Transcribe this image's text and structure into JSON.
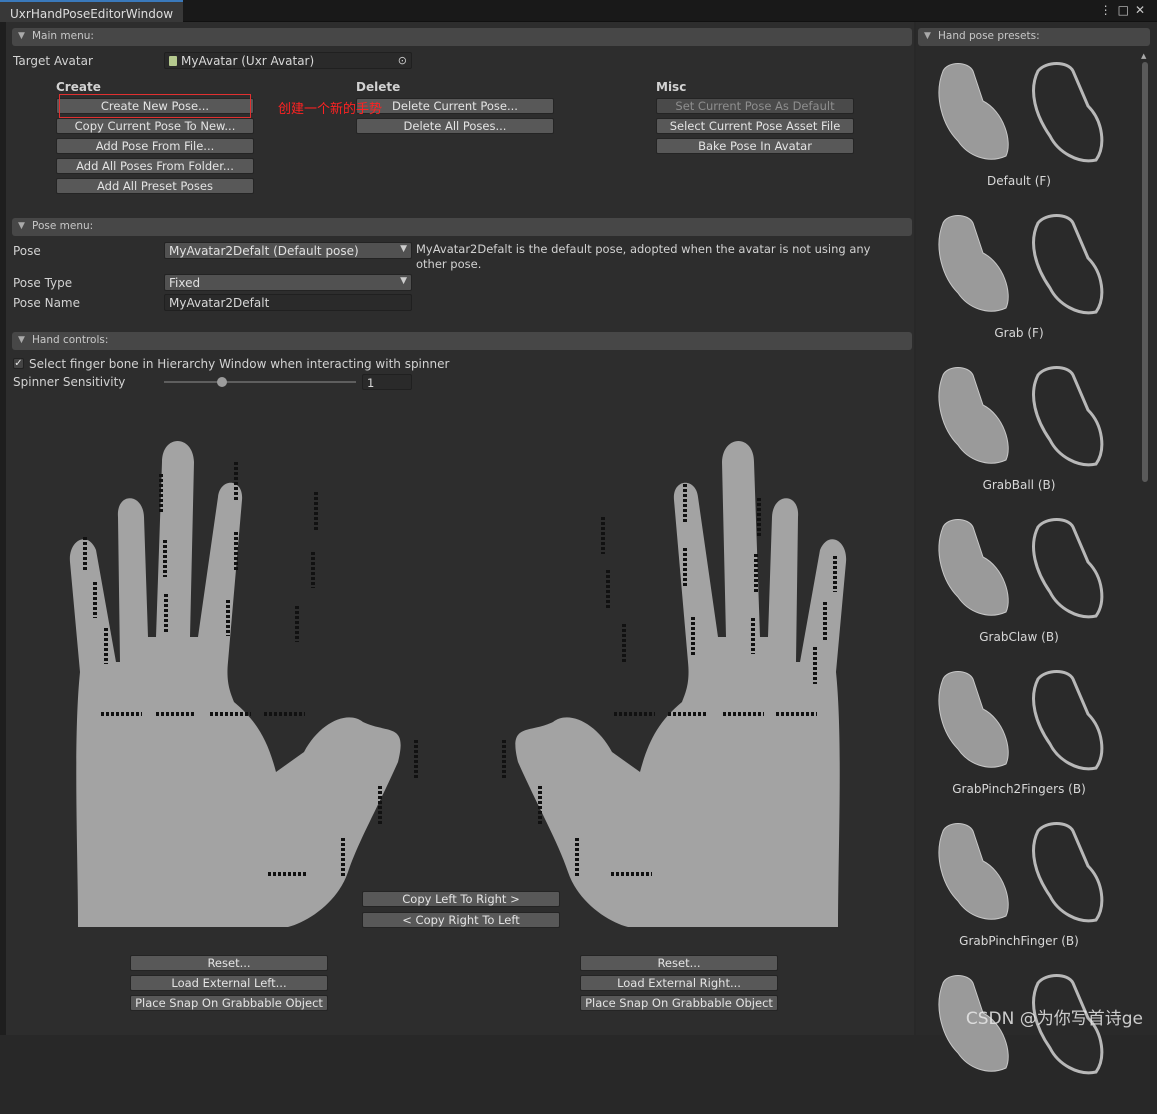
{
  "window": {
    "tab_title": "UxrHandPoseEditorWindow"
  },
  "main_menu": {
    "header": "Main menu:",
    "target_avatar_label": "Target Avatar",
    "target_avatar_value": "MyAvatar (Uxr Avatar)",
    "create": {
      "title": "Create",
      "buttons": [
        "Create New Pose...",
        "Copy Current Pose To New...",
        "Add Pose From File...",
        "Add All Poses From Folder...",
        "Add All Preset Poses"
      ]
    },
    "delete": {
      "title": "Delete",
      "buttons": [
        "Delete Current Pose...",
        "Delete All Poses..."
      ]
    },
    "misc": {
      "title": "Misc",
      "buttons": [
        "Set Current Pose As Default",
        "Select Current Pose Asset File",
        "Bake Pose In Avatar"
      ]
    }
  },
  "annotation": {
    "text": "创建一个新的手势",
    "color": "#e03030"
  },
  "pose_menu": {
    "header": "Pose menu:",
    "pose_label": "Pose",
    "pose_value": "MyAvatar2Defalt (Default pose)",
    "pose_info": "MyAvatar2Defalt is the default pose, adopted when the avatar is not using any other pose.",
    "pose_type_label": "Pose Type",
    "pose_type_value": "Fixed",
    "pose_name_label": "Pose Name",
    "pose_name_value": "MyAvatar2Defalt"
  },
  "hand_controls": {
    "header": "Hand controls:",
    "select_finger_checkbox": {
      "label": "Select finger bone in Hierarchy Window when interacting with spinner",
      "checked": true
    },
    "spinner_label": "Spinner Sensitivity",
    "spinner_value": "1",
    "spinner_fraction": 0.3,
    "copy_left_to_right": "Copy Left To Right >",
    "copy_right_to_left": "< Copy Right To Left",
    "left": {
      "reset": "Reset...",
      "load": "Load External Left...",
      "snap": "Place Snap On Grabbable Object"
    },
    "right": {
      "reset": "Reset...",
      "load": "Load External Right...",
      "snap": "Place Snap On Grabbable Object"
    }
  },
  "sidebar": {
    "header": "Hand pose presets:",
    "presets": [
      "Default (F)",
      "Grab (F)",
      "GrabBall (B)",
      "GrabClaw (B)",
      "GrabPinch2Fingers (B)",
      "GrabPinchFinger (B)",
      ""
    ]
  },
  "watermark": "CSDN @为你写首诗ge",
  "colors": {
    "accent": "#3a79bb",
    "hand": "#a3a3a3",
    "panel": "#2d2d2d",
    "button": "#585858"
  }
}
